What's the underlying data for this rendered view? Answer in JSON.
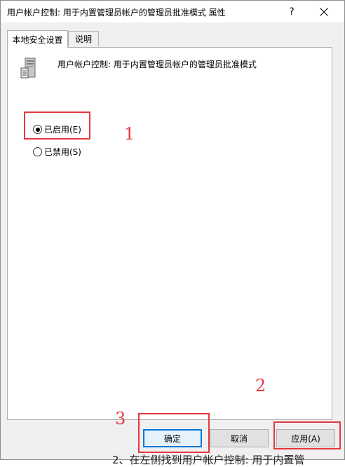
{
  "window": {
    "title": "用户帐户控制: 用于内置管理员帐户的管理员批准模式 属性",
    "help_label": "?"
  },
  "tabs": [
    {
      "label": "本地安全设置",
      "active": true
    },
    {
      "label": "说明",
      "active": false
    }
  ],
  "policy": {
    "name": "用户帐户控制: 用于内置管理员帐户的管理员批准模式",
    "icon": "server-icon"
  },
  "options": [
    {
      "label": "已启用(E)",
      "selected": true
    },
    {
      "label": "已禁用(S)",
      "selected": false
    }
  ],
  "buttons": {
    "ok": "确定",
    "cancel": "取消",
    "apply": "应用(A)"
  },
  "annotations": {
    "n1": "1",
    "n2": "2",
    "n3": "3",
    "color": "#e4383e"
  },
  "background_text": "2、在左侧找到用户帐户控制: 用于内置管"
}
